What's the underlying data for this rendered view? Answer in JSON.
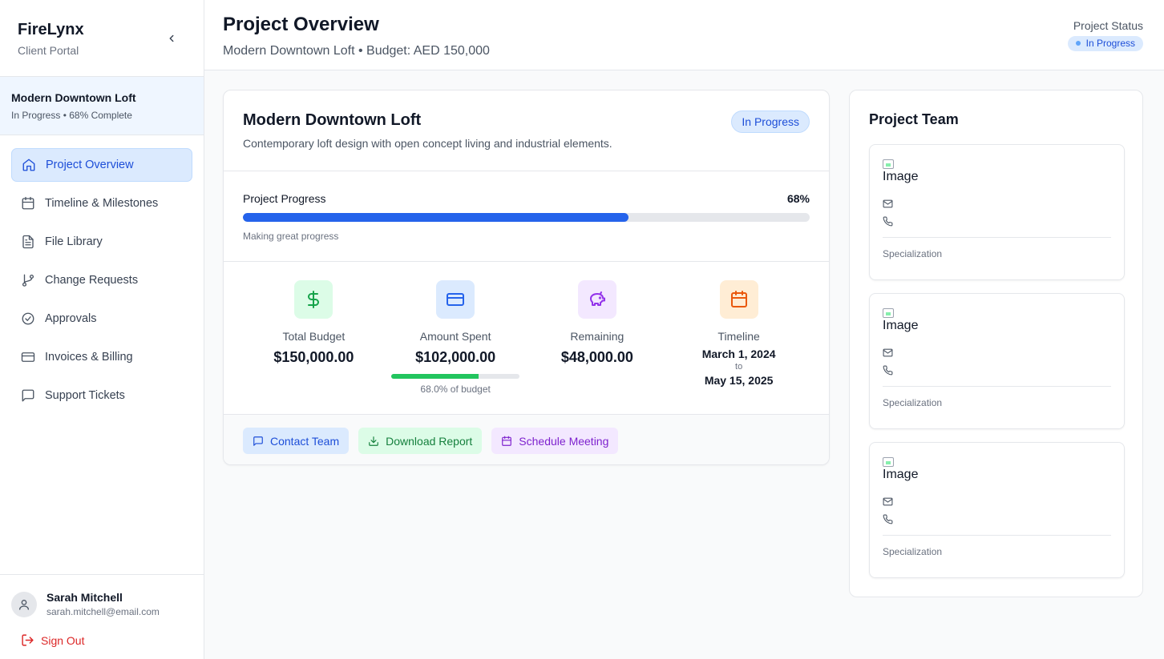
{
  "brand": {
    "name": "FireLynx",
    "subtitle": "Client Portal"
  },
  "sidebar": {
    "project": {
      "name": "Modern Downtown Loft",
      "meta": "In Progress • 68% Complete"
    },
    "items": [
      {
        "label": "Project Overview",
        "icon": "home-icon",
        "active": true
      },
      {
        "label": "Timeline & Milestones",
        "icon": "calendar-icon"
      },
      {
        "label": "File Library",
        "icon": "file-icon"
      },
      {
        "label": "Change Requests",
        "icon": "git-branch-icon"
      },
      {
        "label": "Approvals",
        "icon": "check-circle-icon"
      },
      {
        "label": "Invoices & Billing",
        "icon": "credit-card-icon"
      },
      {
        "label": "Support Tickets",
        "icon": "message-icon"
      }
    ],
    "user": {
      "name": "Sarah Mitchell",
      "email": "sarah.mitchell@email.com"
    },
    "signout_label": "Sign Out"
  },
  "header": {
    "title": "Project Overview",
    "subtitle": "Modern Downtown Loft • Budget: AED 150,000",
    "status_label": "Project Status",
    "status_value": "In Progress"
  },
  "project": {
    "title": "Modern Downtown Loft",
    "description": "Contemporary loft design with open concept living and industrial elements.",
    "badge": "In Progress",
    "progress": {
      "label": "Project Progress",
      "percent_label": "68%",
      "value": 0.68,
      "note": "Making great progress"
    },
    "stats": {
      "total_budget": {
        "label": "Total Budget",
        "value": "$150,000.00"
      },
      "amount_spent": {
        "label": "Amount Spent",
        "value": "$102,000.00",
        "fraction": 0.68,
        "note": "68.0% of budget"
      },
      "remaining": {
        "label": "Remaining",
        "value": "$48,000.00"
      },
      "timeline": {
        "label": "Timeline",
        "start": "March 1, 2024",
        "to": "to",
        "end": "May 15, 2025"
      }
    },
    "actions": {
      "contact": "Contact Team",
      "download": "Download Report",
      "schedule": "Schedule Meeting"
    }
  },
  "team": {
    "title": "Project Team",
    "members": [
      {
        "image_alt": "Image",
        "specialization": "Specialization"
      },
      {
        "image_alt": "Image",
        "specialization": "Specialization"
      },
      {
        "image_alt": "Image",
        "specialization": "Specialization"
      }
    ]
  },
  "colors": {
    "accent": "#2563eb",
    "success": "#22c55e",
    "danger": "#dc2626"
  }
}
